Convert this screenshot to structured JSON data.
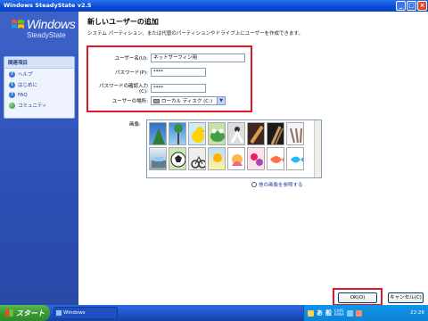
{
  "window": {
    "title": "Windows SteadyState v2.5"
  },
  "titlebar_buttons": [
    "_",
    "□",
    "×"
  ],
  "sidebar": {
    "logo_text": "Windows",
    "logo_sub": "SteadyState",
    "related_header": "関連項目",
    "items": [
      {
        "label": "ヘルプ",
        "icon": "help-icon"
      },
      {
        "label": "はじめに",
        "icon": "info-icon"
      },
      {
        "label": "FAQ",
        "icon": "faq-icon"
      },
      {
        "label": "コミュニティ",
        "icon": "globe-icon"
      }
    ]
  },
  "main": {
    "title": "新しいユーザーの追加",
    "subtitle": "システム パーティション、または代替のパーティションやドライブ上にユーザーを作成できます。",
    "form": {
      "username_label": "ユーザー名(U):",
      "username_value": "ネットサーフィン用",
      "password_label": "パスワード(P):",
      "password_value": "****",
      "confirm_label": "パスワードの確認入力(C):",
      "confirm_value": "****",
      "location_label": "ユーザーの場所:",
      "location_value": "ローカル ディスク (C:)"
    },
    "picture_label": "画像:",
    "more_pictures_link": "他の画像を参照する",
    "ok_button": "OK(O)",
    "cancel_button": "キャンセル(C)"
  },
  "taskbar": {
    "start_label": "スタート",
    "task_label": "Windows SteadyState...",
    "tray_ime": "あ",
    "tray_general": "般",
    "tray_caps": "CAPS",
    "tray_kana": "KANA",
    "time": "22:26"
  }
}
